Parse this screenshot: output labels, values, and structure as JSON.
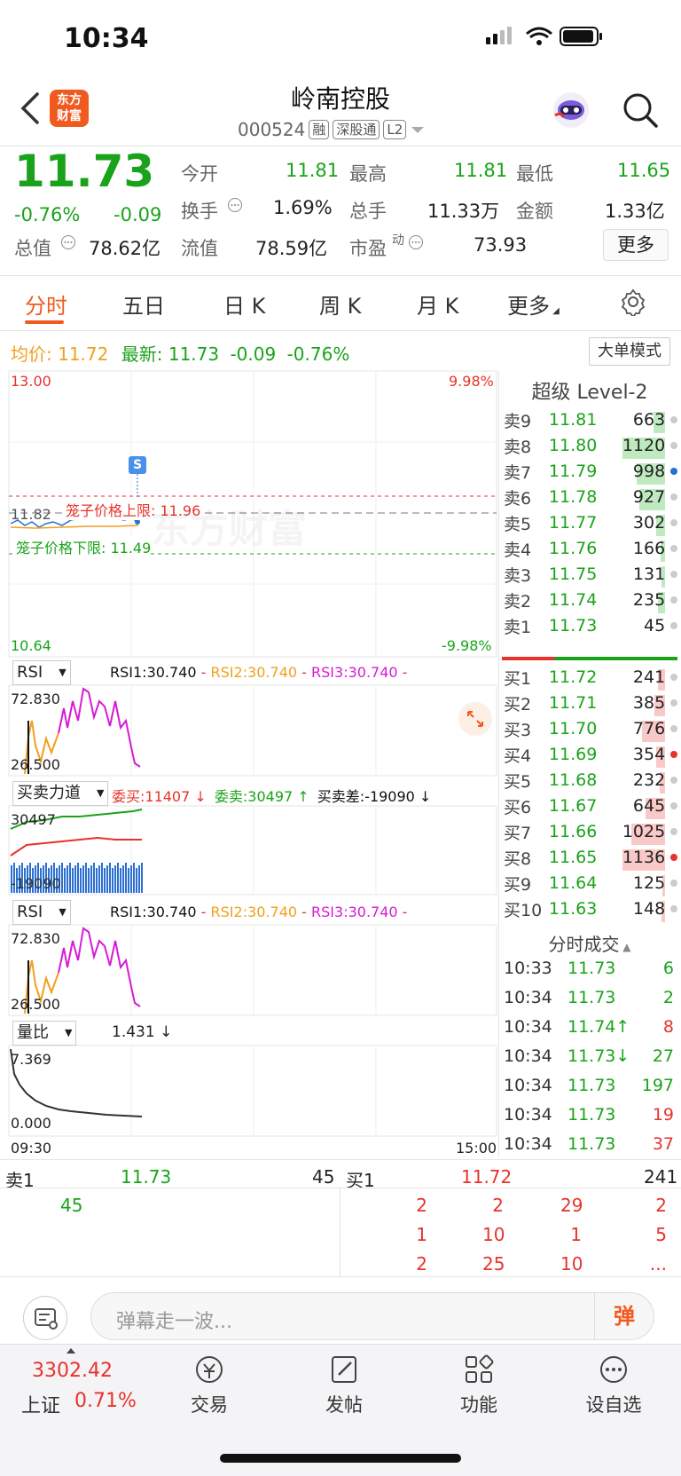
{
  "status": {
    "time": "10:34"
  },
  "header": {
    "logo_line1": "东方",
    "logo_line2": "财富",
    "title": "岭南控股",
    "code": "000524",
    "tags": [
      "融",
      "深股通",
      "L2"
    ]
  },
  "quote": {
    "price": "11.73",
    "change_pct": "-0.76%",
    "change": "-0.09",
    "open_label": "今开",
    "open": "11.81",
    "high_label": "最高",
    "high": "11.81",
    "low_label": "最低",
    "low": "11.65",
    "turnover_label": "换手",
    "turnover": "1.69%",
    "volume_label": "总手",
    "volume": "11.33万",
    "amount_label": "金额",
    "amount": "1.33亿",
    "mktcap_label": "总值",
    "mktcap": "78.62亿",
    "float_label": "流值",
    "float": "78.59亿",
    "pe_label": "市盈",
    "pe_sup": "动",
    "pe": "73.93",
    "more_label": "更多"
  },
  "tabs": [
    "分时",
    "五日",
    "日 K",
    "周 K",
    "月 K",
    "更多"
  ],
  "chart": {
    "avg_label": "均价:",
    "avg": "11.72",
    "latest_label": "最新:",
    "latest": "11.73",
    "latest_change": "-0.09",
    "latest_pct": "-0.76%",
    "dadan_label": "大单模式",
    "y_top": "13.00",
    "y_bottom": "10.64",
    "pct_top": "9.98%",
    "pct_bottom": "-9.98%",
    "prev_close": "11.82",
    "cage_upper": "笼子价格上限: 11.96",
    "cage_lower": "笼子价格下限: 11.49",
    "s_marker": "S",
    "watermark": "东方财富",
    "time_start": "09:30",
    "time_end": "15:00",
    "rsi": {
      "selector": "RSI",
      "rsi1": "RSI1:30.740",
      "rsi2": "RSI2:30.740",
      "rsi3": "RSI3:30.740",
      "sep": "-",
      "y_top": "72.830",
      "y_bottom": "26.500"
    },
    "force": {
      "selector": "买卖力道",
      "buy": "委买:11407 ↓",
      "sell": "委卖:30497 ↑",
      "diff": "买卖差:-19090 ↓",
      "y_top": "30497",
      "y_bottom": "-19090"
    },
    "ratio": {
      "selector": "量比",
      "value": "1.431 ↓",
      "y_top": "7.369",
      "y_bottom": "0.000"
    }
  },
  "orderbook": {
    "title": "超级 Level-2",
    "asks": [
      {
        "label": "卖9",
        "price": "11.81",
        "vol": "663",
        "bar": 0.2
      },
      {
        "label": "卖8",
        "price": "11.80",
        "vol": "1120",
        "bar": 0.75
      },
      {
        "label": "卖7",
        "price": "11.79",
        "vol": "998",
        "bar": 0.5
      },
      {
        "label": "卖6",
        "price": "11.78",
        "vol": "927",
        "bar": 0.45
      },
      {
        "label": "卖5",
        "price": "11.77",
        "vol": "302",
        "bar": 0.15
      },
      {
        "label": "卖4",
        "price": "11.76",
        "vol": "166",
        "bar": 0.08
      },
      {
        "label": "卖3",
        "price": "11.75",
        "vol": "131",
        "bar": 0.06
      },
      {
        "label": "卖2",
        "price": "11.74",
        "vol": "235",
        "bar": 0.12
      },
      {
        "label": "卖1",
        "price": "11.73",
        "vol": "45",
        "bar": 0.0
      }
    ],
    "bids": [
      {
        "label": "买1",
        "price": "11.72",
        "vol": "241",
        "bar": 0.12
      },
      {
        "label": "买2",
        "price": "11.71",
        "vol": "385",
        "bar": 0.18
      },
      {
        "label": "买3",
        "price": "11.70",
        "vol": "776",
        "bar": 0.4
      },
      {
        "label": "买4",
        "price": "11.69",
        "vol": "354",
        "bar": 0.15
      },
      {
        "label": "买5",
        "price": "11.68",
        "vol": "232",
        "bar": 0.1
      },
      {
        "label": "买6",
        "price": "11.67",
        "vol": "645",
        "bar": 0.35
      },
      {
        "label": "买7",
        "price": "11.66",
        "vol": "1025",
        "bar": 0.6
      },
      {
        "label": "买8",
        "price": "11.65",
        "vol": "1136",
        "bar": 0.75
      },
      {
        "label": "买9",
        "price": "11.64",
        "vol": "125",
        "bar": 0.05
      },
      {
        "label": "买10",
        "price": "11.63",
        "vol": "148",
        "bar": 0.06
      }
    ],
    "ticks_title": "分时成交",
    "ticks": [
      {
        "time": "10:33",
        "price": "11.73",
        "vol": "6",
        "color": "#1aa31a"
      },
      {
        "time": "10:34",
        "price": "11.73",
        "vol": "2",
        "color": "#1aa31a"
      },
      {
        "time": "10:34",
        "price": "11.74↑",
        "vol": "8",
        "color": "#e8322b"
      },
      {
        "time": "10:34",
        "price": "11.73↓",
        "vol": "27",
        "color": "#1aa31a"
      },
      {
        "time": "10:34",
        "price": "11.73",
        "vol": "197",
        "color": "#1aa31a"
      },
      {
        "time": "10:34",
        "price": "11.73",
        "vol": "19",
        "color": "#e8322b"
      },
      {
        "time": "10:34",
        "price": "11.73",
        "vol": "37",
        "color": "#e8322b"
      }
    ]
  },
  "trade": {
    "ask_label": "卖1",
    "ask_price": "11.73",
    "ask_vol": "45",
    "bid_label": "买1",
    "bid_price": "11.72",
    "bid_vol": "241",
    "ask_queue": [
      "45"
    ],
    "bid_queue": [
      [
        "2",
        "2",
        "29",
        "2"
      ],
      [
        "1",
        "10",
        "1",
        "5"
      ],
      [
        "2",
        "25",
        "10",
        "..."
      ]
    ]
  },
  "danmaku": {
    "placeholder": "弹幕走一波...",
    "send": "弹"
  },
  "nav": {
    "index_value": "3302.42",
    "index_name": "上证",
    "index_pct": "0.71%",
    "items": [
      "交易",
      "发帖",
      "功能",
      "设自选"
    ]
  },
  "colors": {
    "accent": "#f05a1e",
    "up": "#e8322b",
    "down": "#1aa31a"
  }
}
